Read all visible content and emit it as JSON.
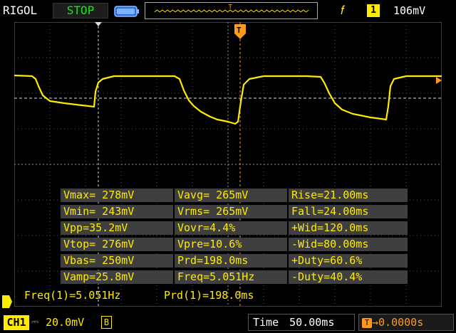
{
  "header": {
    "brand": "RIGOL",
    "run_state": "STOP",
    "trigger": {
      "edge_icon": "rising-edge-icon",
      "source": "1",
      "level": "106mV"
    }
  },
  "markers": {
    "trigger_position": "T"
  },
  "measurements": [
    [
      "Vmax= 278mV",
      "Vavg= 265mV",
      "Rise=21.00ms"
    ],
    [
      "Vmin= 243mV",
      "Vrms= 265mV",
      "Fall=24.00ms"
    ],
    [
      "Vpp=35.2mV",
      "Vovr=4.4%",
      "+Wid=120.0ms"
    ],
    [
      "Vtop= 276mV",
      "Vpre=10.6%",
      "-Wid=80.00ms"
    ],
    [
      "Vbas= 250mV",
      "Prd=198.0ms",
      "+Duty=60.6%"
    ],
    [
      "Vamp=25.8mV",
      "Freq=5.051Hz",
      "-Duty=40.4%"
    ]
  ],
  "readouts": {
    "freq": "Freq(1)=5.051Hz",
    "period": "Prd(1)=198.0ms"
  },
  "channel": {
    "label": "CH1",
    "coupling_icon": "dc-coupling-icon",
    "scale": "20.0mV",
    "bw_limit": "B"
  },
  "timebase": {
    "label": "Time",
    "scale": "50.00ms",
    "offset": "0.0000s"
  },
  "colors": {
    "trace": "#ffeb00",
    "stop_text": "#19e619",
    "trigger_marker": "#ff9a1f",
    "panel_bg": "#3f3f3f"
  }
}
